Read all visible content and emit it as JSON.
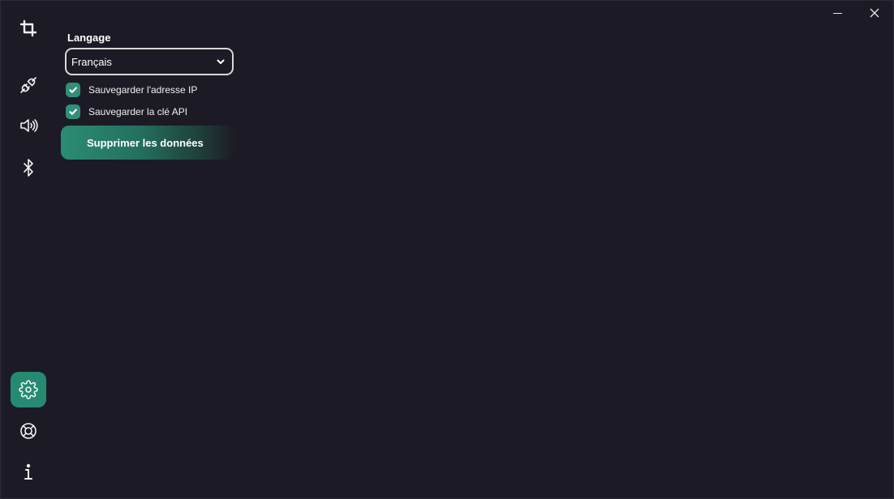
{
  "window": {
    "minimize_icon": "minimize-icon",
    "close_icon": "close-icon"
  },
  "sidebar": {
    "items": [
      {
        "name": "crop",
        "icon": "crop-icon"
      },
      {
        "name": "plug",
        "icon": "plug-icon"
      },
      {
        "name": "sound",
        "icon": "speaker-icon"
      },
      {
        "name": "bluetooth",
        "icon": "bluetooth-icon"
      },
      {
        "name": "settings",
        "icon": "gear-icon",
        "active": true
      },
      {
        "name": "help",
        "icon": "lifebuoy-icon"
      },
      {
        "name": "info",
        "icon": "info-icon"
      }
    ]
  },
  "settings": {
    "language_label": "Langage",
    "language_value": "Français",
    "save_ip_label": "Sauvegarder l'adresse IP",
    "save_ip_checked": true,
    "save_api_key_label": "Sauvegarder la clé API",
    "save_api_key_checked": true,
    "delete_data_label": "Supprimer les données"
  },
  "colors": {
    "background": "#1c1b25",
    "accent": "#268a73",
    "checkbox": "#2f8f78"
  }
}
